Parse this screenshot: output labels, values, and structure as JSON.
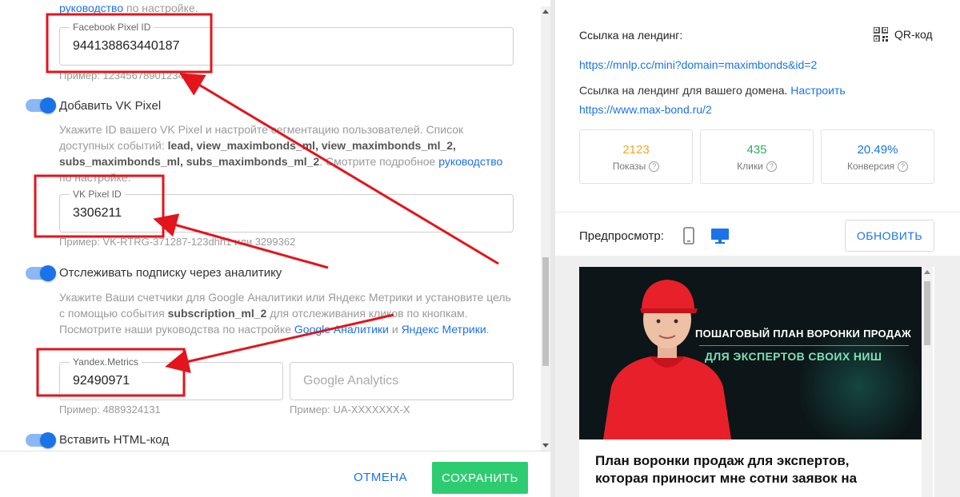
{
  "left": {
    "top_line": {
      "link": "руководство",
      "rest": " по настройке."
    },
    "facebook": {
      "label": "Facebook Pixel ID",
      "value": "944138863440187",
      "hint": "Пример: 123456789012345"
    },
    "vk_toggle_label": "Добавить VK Pixel",
    "vk_desc": {
      "p1": "Укажите ID вашего VK Pixel и настройте сегментацию пользователей. Список доступных событий: ",
      "events": "lead, view_maximbonds_ml, view_maximbonds_ml_2, subs_maximbonds_ml, subs_maximbonds_ml_2",
      "p2": ". Смотрите подробное ",
      "link": "руководство",
      "p3": " по настройке."
    },
    "vk": {
      "label": "VK Pixel ID",
      "value": "3306211",
      "hint": "Пример: VK-RTRG-371287-123dhh1 или 3299362"
    },
    "analytics_toggle_label": "Отслеживать подписку через аналитику",
    "analytics_desc": {
      "p1": "Укажите Ваши счетчики для Google Аналитики или Яндекс Метрики и установите цель с помощью события ",
      "event": "subscription_ml_2",
      "p2": " для отслеживания кликов по кнопкам. Посмотрите наши руководства по настройке ",
      "link1": "Google Аналитики",
      "p3": " и ",
      "link2": "Яндекс Метрики",
      "p4": "."
    },
    "yandex": {
      "label": "Yandex.Metrics",
      "value": "92490971",
      "hint": "Пример: 4889324131"
    },
    "google": {
      "placeholder": "Google Analytics",
      "hint": "Пример: UA-XXXXXXX-X"
    },
    "html_toggle_label": "Вставить HTML-код",
    "cancel": "ОТМЕНА",
    "save": "СОХРАНИТЬ"
  },
  "right": {
    "link_title": "Ссылка на лендинг:",
    "qr_label": "QR-код",
    "landing_url": "https://mnlp.cc/mini?domain=maximbonds&id=2",
    "domain_text": "Ссылка на лендинг для вашего домена. ",
    "domain_setup": "Настроить",
    "domain_url": "https://www.max-bond.ru/2",
    "stats": [
      {
        "value": "2123",
        "label": "Показы",
        "color": "#f5a623"
      },
      {
        "value": "435",
        "label": "Клики",
        "color": "#27ae60"
      },
      {
        "value": "20.49%",
        "label": "Конверсия",
        "color": "#1a73e8"
      }
    ],
    "preview_label": "Предпросмотр:",
    "refresh": "ОБНОВИТЬ",
    "banner_line1": "ПОШАГОВЫЙ ПЛАН ВОРОНКИ ПРОДАЖ",
    "banner_line2": "ДЛЯ ЭКСПЕРТОВ СВОИХ НИШ",
    "preview_title": "План воронки продаж для экспертов, которая приносит мне сотни заявок на"
  },
  "colors": {
    "accent": "#1a73e8",
    "save": "#2ecc71",
    "annotation": "#e3141b"
  }
}
